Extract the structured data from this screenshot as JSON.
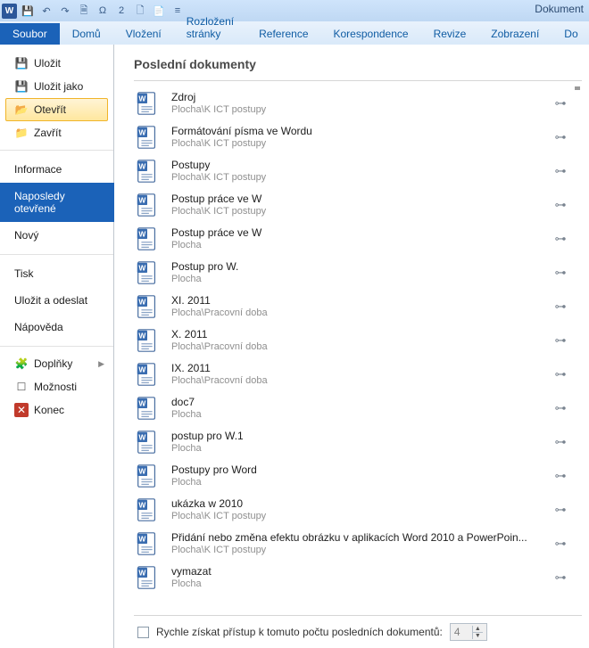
{
  "titlebar": {
    "doc_title": "Dokument",
    "quick_access": [
      "💾",
      "↶",
      "↷",
      "🗎",
      "Ω",
      "2",
      "🗋",
      "📄",
      "≡"
    ]
  },
  "ribbon": {
    "file": "Soubor",
    "tabs": [
      "Domů",
      "Vložení",
      "Rozložení stránky",
      "Reference",
      "Korespondence",
      "Revize",
      "Zobrazení",
      "Do"
    ]
  },
  "side": {
    "ulozit": "Uložit",
    "ulozit_jako": "Uložit jako",
    "otevrit": "Otevřít",
    "zavrit": "Zavřít",
    "informace": "Informace",
    "naposledy": "Naposledy otevřené",
    "novy": "Nový",
    "tisk": "Tisk",
    "ulozit_odeslat": "Uložit a odeslat",
    "napoveda": "Nápověda",
    "doplnky": "Doplňky",
    "moznosti": "Možnosti",
    "konec": "Konec"
  },
  "main": {
    "heading": "Poslední dokumenty",
    "footer_label": "Rychle získat přístup k tomuto počtu posledních dokumentů:",
    "footer_value": "4"
  },
  "docs": [
    {
      "name": "Zdroj",
      "path": "Plocha\\K ICT postupy"
    },
    {
      "name": "Formátování písma ve Wordu",
      "path": "Plocha\\K ICT postupy"
    },
    {
      "name": "Postupy",
      "path": "Plocha\\K ICT postupy"
    },
    {
      "name": "Postup práce ve W",
      "path": "Plocha\\K ICT postupy"
    },
    {
      "name": "Postup práce ve W",
      "path": "Plocha"
    },
    {
      "name": "Postup pro W.",
      "path": "Plocha"
    },
    {
      "name": "XI. 2011",
      "path": "Plocha\\Pracovní doba"
    },
    {
      "name": "X. 2011",
      "path": "Plocha\\Pracovní doba"
    },
    {
      "name": "IX. 2011",
      "path": "Plocha\\Pracovní doba"
    },
    {
      "name": "doc7",
      "path": "Plocha"
    },
    {
      "name": "postup pro W.1",
      "path": "Plocha"
    },
    {
      "name": "Postupy pro Word",
      "path": "Plocha"
    },
    {
      "name": "ukázka w 2010",
      "path": "Plocha\\K ICT postupy"
    },
    {
      "name": "Přidání nebo změna efektu obrázku v aplikacích Word 2010 a PowerPoin...",
      "path": "Plocha\\K ICT postupy"
    },
    {
      "name": "vymazat",
      "path": "Plocha"
    }
  ]
}
